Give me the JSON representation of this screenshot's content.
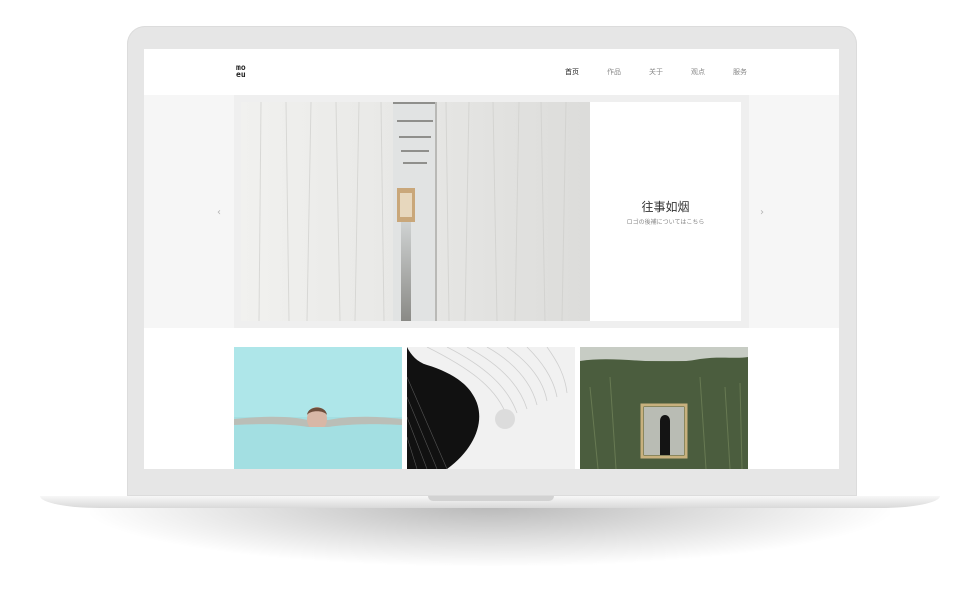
{
  "site": {
    "logo_top": "mo",
    "logo_bottom": "eu",
    "nav": [
      "首页",
      "作品",
      "关于",
      "观点",
      "服务"
    ]
  },
  "hero": {
    "title": "往事如烟",
    "subtitle": "ロゴの後補についてはこちら",
    "prev_icon": "‹",
    "next_icon": "›"
  },
  "colors": {
    "screen_bg": "#ffffff",
    "hero_bg": "#f6f6f6",
    "lid": "#e6e6e6",
    "pool": "#a9e6e8",
    "grass": "#4e6040"
  }
}
